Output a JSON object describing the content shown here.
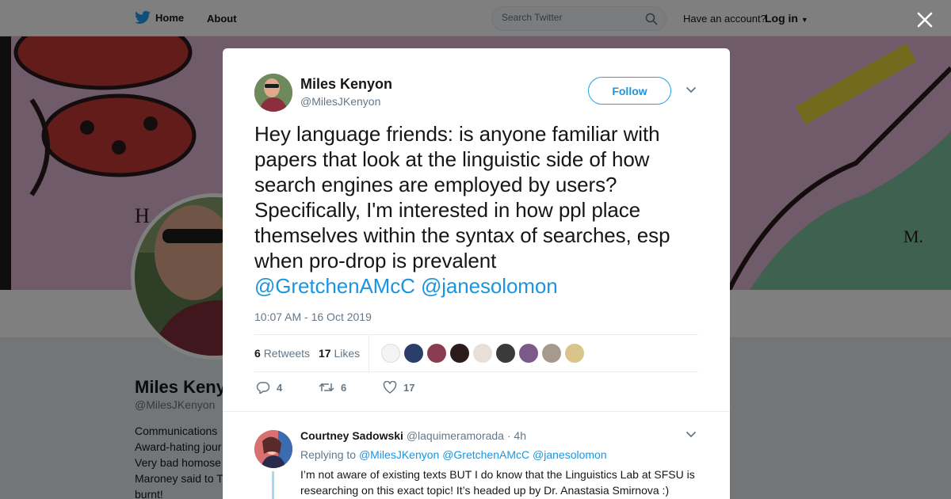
{
  "nav": {
    "home_label": "Home",
    "about_label": "About",
    "search_placeholder": "Search Twitter",
    "account_prompt": "Have an account?",
    "login_label": "Log in"
  },
  "profile": {
    "name": "Miles Kenyon",
    "handle": "@MilesJKenyon",
    "bio_lines": [
      "Communications",
      "Award-hating jour",
      "Very bad homose",
      "Maroney said to T",
      "burnt!"
    ]
  },
  "tweet": {
    "author_name": "Miles Kenyon",
    "author_handle": "@MilesJKenyon",
    "follow_label": "Follow",
    "text": "Hey language friends: is anyone familiar with papers that look at the linguistic side of how search engines are employed by users? Specifically, I'm interested in how ppl place themselves within the syntax of searches, esp when pro-drop is prevalent",
    "mention_1": "@GretchenAMcC",
    "mention_2": "@janesolomon",
    "timestamp": "10:07 AM - 16 Oct 2019",
    "retweets_count": "6",
    "retweets_label": "Retweets",
    "likes_count": "17",
    "likes_label": "Likes",
    "reply_count": "4",
    "retweet_action_count": "6",
    "like_action_count": "17"
  },
  "reply": {
    "name": "Courtney Sadowski",
    "handle": "@laquimeramorada",
    "time": "· 4h",
    "replying_prefix": "Replying to",
    "replying_to": [
      "@MilesJKenyon",
      "@GretchenAMcC",
      "@janesolomon"
    ],
    "text": "I’m not aware of existing texts BUT I do know that the Linguistics Lab at SFSU is researching on this exact topic! It’s headed up by Dr. Anastasia Smirnova :)"
  },
  "colors": {
    "twitter_blue": "#1da1f2",
    "link_blue": "#1b95e0",
    "text_dark": "#14171a",
    "text_muted": "#657786"
  }
}
